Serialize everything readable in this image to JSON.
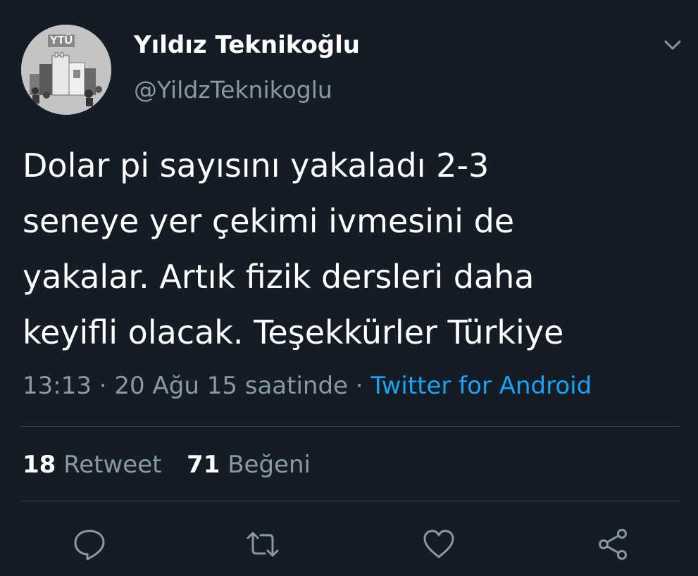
{
  "user": {
    "avatar_text": "YTÜ",
    "display_name": "Yıldız Teknikoğlu",
    "handle": "@YildzTeknikoglu"
  },
  "tweet": {
    "lines": [
      "Dolar pi sayısını yakaladı 2-3",
      "seneye yer çekimi ivmesini de",
      "yakalar. Artık fizik dersleri daha",
      "keyifli olacak. Teşekkürler Türkiye"
    ]
  },
  "meta": {
    "time": "13:13",
    "separator": " · ",
    "date": "20 Ağu 15 saatinde",
    "source": "Twitter for Android"
  },
  "stats": {
    "retweet_count": "18",
    "retweet_label": "Retweet",
    "like_count": "71",
    "like_label": "Beğeni"
  },
  "actions": [
    "reply-icon",
    "retweet-icon",
    "like-icon",
    "share-icon"
  ],
  "colors": {
    "background": "#141d26",
    "secondary_text": "#8899a6",
    "link": "#1da1f2",
    "divider": "#38444d"
  }
}
